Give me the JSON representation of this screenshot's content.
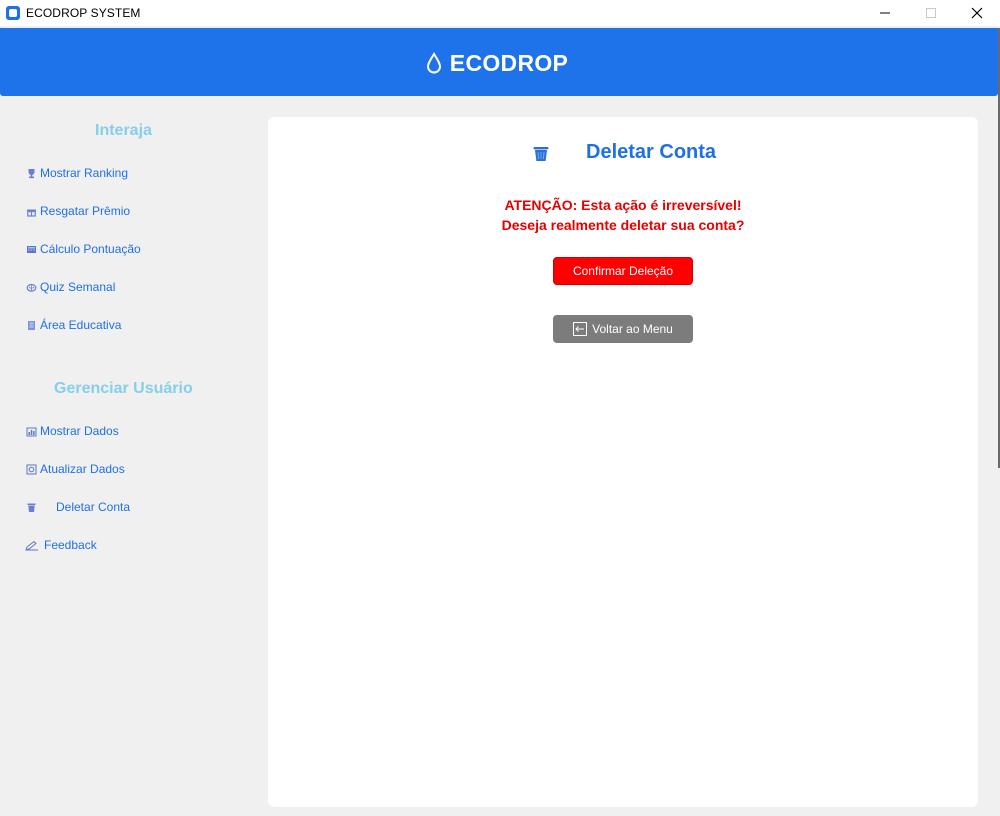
{
  "window": {
    "title": "ECODROP SYSTEM",
    "controls": [
      "minimize-icon",
      "maximize-icon",
      "close-icon"
    ]
  },
  "header": {
    "title": "ECODROP",
    "icon": "water-drop-icon",
    "color": "#1f73ea"
  },
  "sidebar": {
    "sections": [
      {
        "title": "Interaja",
        "items": [
          {
            "label": "Mostrar Ranking",
            "icon": "trophy-icon"
          },
          {
            "label": "Resgatar Prêmio",
            "icon": "gift-icon"
          },
          {
            "label": "Cálculo Pontuação",
            "icon": "calculator-icon"
          },
          {
            "label": "Quiz Semanal",
            "icon": "brain-icon"
          },
          {
            "label": "Área Educativa",
            "icon": "book-icon"
          }
        ]
      },
      {
        "title": "Gerenciar Usuário",
        "items": [
          {
            "label": "Mostrar Dados",
            "icon": "chart-icon"
          },
          {
            "label": "Atualizar Dados",
            "icon": "refresh-icon"
          },
          {
            "label": "Deletar Conta",
            "icon": "trash-icon"
          },
          {
            "label": "Feedback",
            "icon": "pencil-icon"
          }
        ]
      }
    ],
    "title_color": "#87ceeb",
    "link_color": "#1f6fe6"
  },
  "main": {
    "title": "Deletar Conta",
    "title_icon": "trash-icon",
    "warning_line1": "ATENÇÃO: Esta ação é irreversível!",
    "warning_line2": "Deseja realmente deletar sua conta?",
    "warning_color": "#e60000",
    "confirm_button": "Confirmar Deleção",
    "confirm_color": "#ff0000",
    "back_button": "Voltar ao Menu",
    "back_icon": "back-arrow-icon",
    "back_color": "#7c7c7c"
  }
}
